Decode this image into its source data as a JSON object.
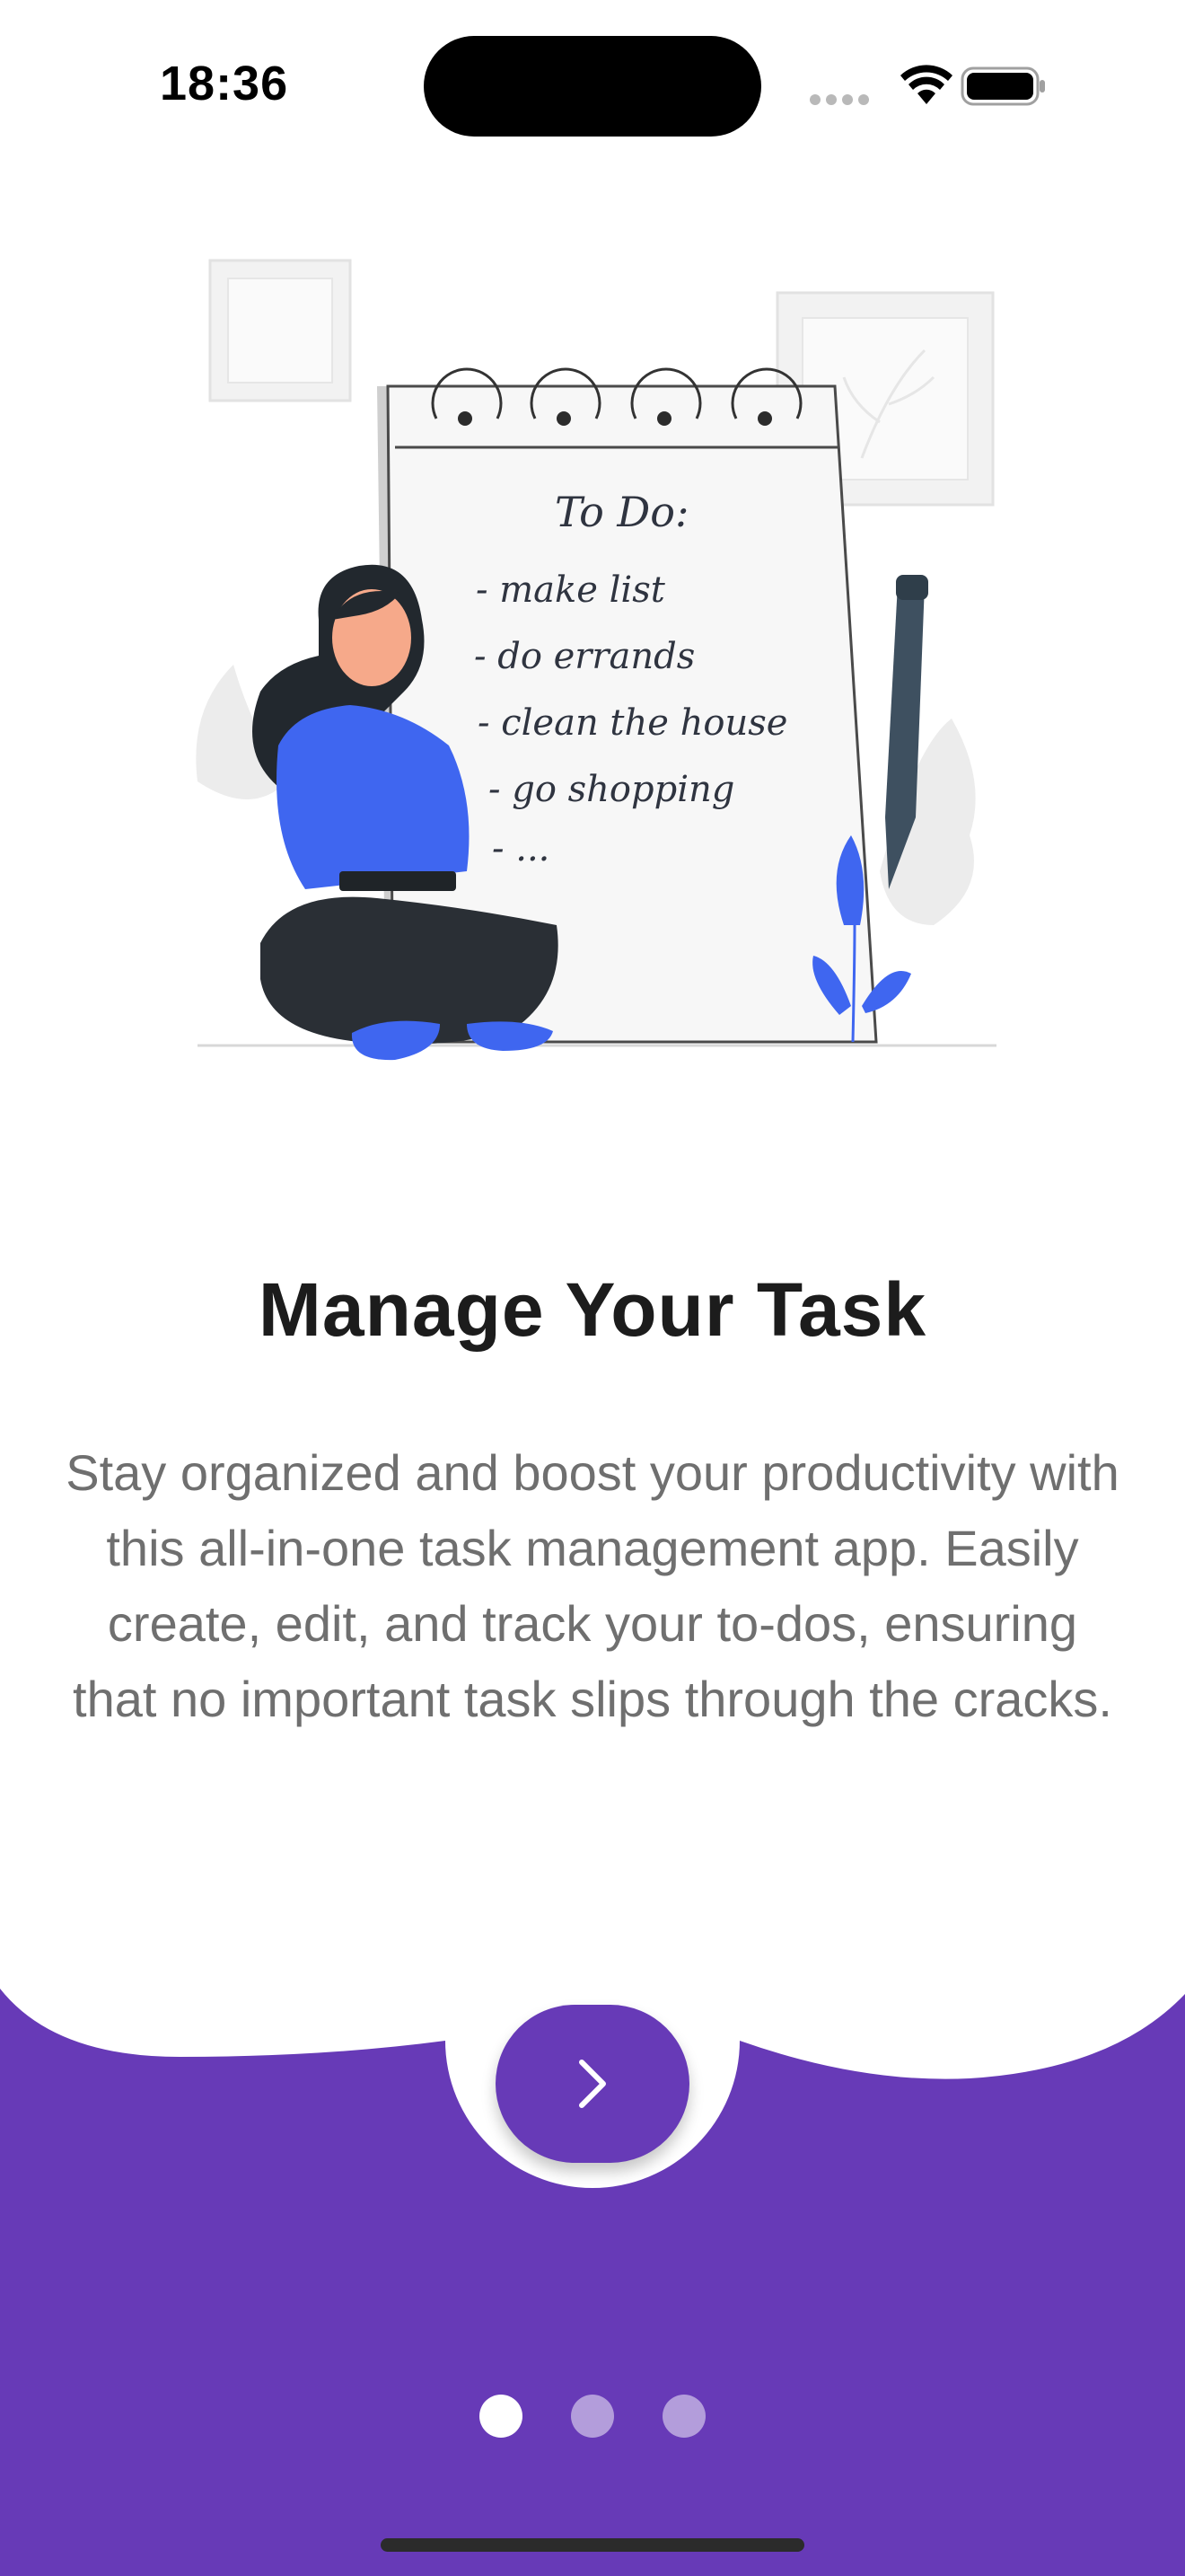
{
  "status_bar": {
    "time": "18:36"
  },
  "illustration": {
    "notepad_heading": "To Do:",
    "notepad_items": [
      "- make list",
      "- do errands",
      "- clean the house",
      "- go shopping",
      "- ..."
    ]
  },
  "onboarding": {
    "title": "Manage Your Task",
    "description": "Stay organized and boost your productivity with this all-in-one task management app. Easily create, edit, and track your to-dos, ensuring that no important task slips through the cracks.",
    "current_page": 1,
    "total_pages": 3
  },
  "next_button": {
    "icon": "chevron-right-icon"
  },
  "colors": {
    "accent": "#673ab7",
    "dot_inactive": "#b39ddb",
    "illustration_blue": "#3f66f0",
    "title": "#1c1c1c",
    "description": "#6f6f6f"
  }
}
